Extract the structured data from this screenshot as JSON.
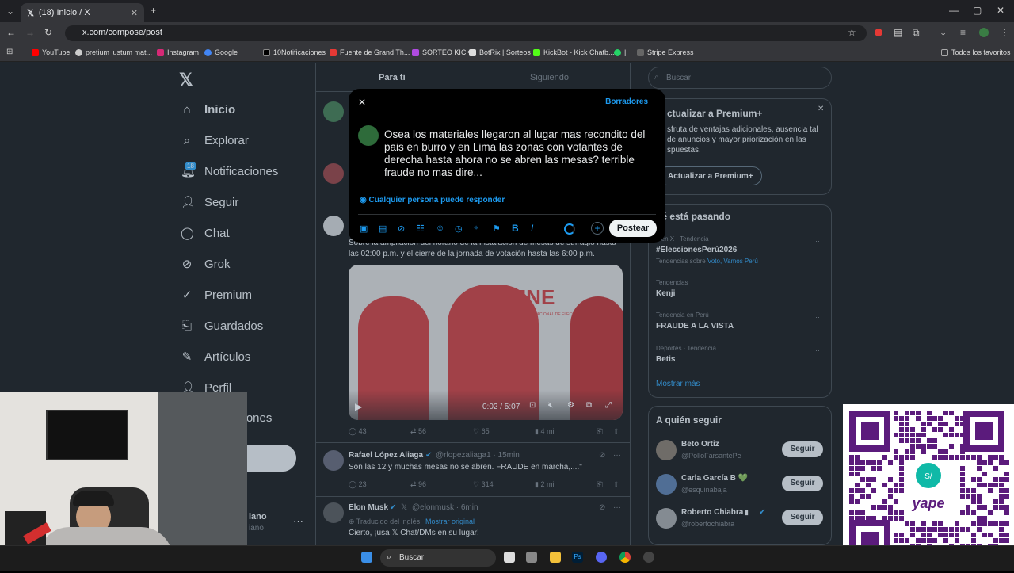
{
  "browser": {
    "tab_title": "(18) Inicio / X",
    "url": "x.com/compose/post",
    "bookmarks": [
      "YouTube",
      "pretium iustum mat...",
      "Instagram",
      "Google",
      "10Notificaciones",
      "Fuente de Grand Th...",
      "SORTEO KICK",
      "BotRix | Sorteos",
      "KickBot - Kick Chatb...",
      "|",
      "Stripe Express"
    ],
    "all_bookmarks": "Todos los favoritos"
  },
  "nav": {
    "items": [
      "Inicio",
      "Explorar",
      "Notificaciones",
      "Seguir",
      "Chat",
      "Grok",
      "Premium",
      "Guardados",
      "Artículos",
      "Perfil",
      "ciones"
    ],
    "notif_badge": "18",
    "profile_name": "iano",
    "profile_handle": "iano"
  },
  "feed": {
    "tab_for_you": "Para ti",
    "tab_following": "Siguiendo",
    "post1_text": "Sobre la ampliación del horario de la instalación de mesas de sufragio hasta las 02:00 p.m. y el cierre de la jornada de votación hasta las 6:00 p.m.",
    "video_time": "0:02 / 5:07",
    "video_brand": "JNE",
    "video_sub": "JURADO NACIONAL DE ELECCIONES",
    "post1_stats": {
      "replies": "43",
      "reposts": "56",
      "likes": "65",
      "views": "4 mil"
    },
    "post2": {
      "name": "Rafael López Aliaga",
      "handle": "@rlopezaliaga1 · 15min",
      "text": "Son las 12 y muchas mesas no se abren. FRAUDE en marcha,....\"",
      "replies": "23",
      "reposts": "96",
      "likes": "314",
      "views": "2 mil"
    },
    "post3": {
      "name": "Elon Musk",
      "handle": "@elonmusk · 6min",
      "translated": "Traducido del inglés",
      "show_original": "Mostrar original",
      "text": "Cierto, ¡usa 𝕏 Chat/DMs en su lugar!"
    }
  },
  "modal": {
    "drafts": "Borradores",
    "text": "Osea los materiales llegaron al lugar mas recondito del pais en burro y en Lima las zonas con votantes de derecha hasta ahora no se abren las mesas? terrible fraude no mas dire...",
    "reply_setting": "Cualquier persona puede responder",
    "post_button": "Postear"
  },
  "sidebar": {
    "search_placeholder": "Buscar",
    "premium_title": "ctualizar a Premium+",
    "premium_text": "sfruta de ventajas adicionales, ausencia tal de anuncios y mayor priorización en las spuestas.",
    "premium_button": "Actualizar a Premium+",
    "trends_title": "ué está pasando",
    "trends": [
      {
        "ctx": "o en X · Tendencia",
        "name": "#EleccionesPerú2026",
        "extra": "Tendencias sobre ",
        "links": "Voto, Vamos Perú"
      },
      {
        "ctx": "Tendencias",
        "name": "Kenji"
      },
      {
        "ctx": "Tendencia en Perú",
        "name": "FRAUDE A LA VISTA"
      },
      {
        "ctx": "Deportes · Tendencia",
        "name": "Betis"
      }
    ],
    "show_more": "Mostrar más",
    "who_to_follow": "A quién seguir",
    "follow": [
      {
        "name": "Beto Ortiz",
        "handle": "@PolloFarsantePe"
      },
      {
        "name": "Carla García B 💚",
        "handle": "@esquinabaja"
      },
      {
        "name": "Roberto Chiabra",
        "handle": "@robertochiabra"
      }
    ],
    "follow_label": "Seguir"
  },
  "taskbar": {
    "search": "Buscar"
  },
  "qr": {
    "label": "yape"
  }
}
